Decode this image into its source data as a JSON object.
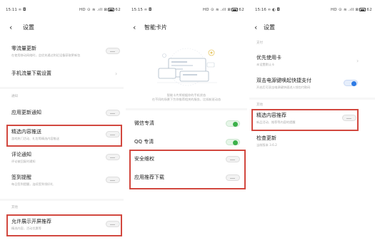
{
  "phone1": {
    "status": {
      "time": "15:11",
      "left_extra": "∞ ◘",
      "icons": "HD ⊙ ≋ .ıll ⊠",
      "battery": "62"
    },
    "title": "设置",
    "items": [
      {
        "title": "零流量更新",
        "subtitle": "在使用移动网络时，会优先通过附近设备获取更新包"
      },
      {
        "title": "手机流量下载设置"
      },
      {
        "section": "通知"
      },
      {
        "title": "应用更新通知"
      },
      {
        "title": "精选内容推送",
        "subtitle": "游戏热门活动、礼包等精选内容推送"
      },
      {
        "title": "评论通知",
        "subtitle": "评论被回复时通知"
      },
      {
        "title": "签到提醒",
        "subtitle": "每日签到提醒，连续签到领好礼"
      },
      {
        "section": "其他"
      },
      {
        "title": "允许展示开屏推荐",
        "subtitle": "精选内容，活动优惠等"
      }
    ]
  },
  "phone2": {
    "status": {
      "time": "15:15",
      "left_extra": "∞ ◘",
      "icons": "HD ⊙ ≋ .ıll ⊠",
      "battery": "62"
    },
    "title": "智能卡片",
    "caption1": "智能卡片将根据你的手机状态",
    "caption2": "在不同的场景下为你推荐相关的服务，比如航班动态",
    "items": [
      {
        "title": "微信专清"
      },
      {
        "title": "QQ 专清"
      },
      {
        "title": "安全维权"
      },
      {
        "title": "应用推荐下载"
      }
    ]
  },
  "phone3": {
    "status": {
      "time": "15:16",
      "left_extra": "∞ ◐ ◘",
      "icons": "HD ⊙ ≋ .ıll ⊠",
      "battery": "62"
    },
    "title": "设置",
    "items": [
      {
        "section": "支付"
      },
      {
        "title": "优先使用卡",
        "subtitle": "未设置默认卡"
      },
      {
        "title": "双击电源键唤起快捷支付",
        "subtitle": "开启后可双击电源键快速进入钱包付款码"
      },
      {
        "section": "其他"
      },
      {
        "title": "精选内容推荐",
        "subtitle": "新品活动、推荐等内容的提醒"
      },
      {
        "title": "检查更新",
        "subtitle": "当前版本 3.6.2"
      }
    ]
  },
  "colors": {
    "highlight": "#d2483f",
    "toggle_green": "#3cb14a",
    "toggle_blue": "#2d7be5"
  }
}
